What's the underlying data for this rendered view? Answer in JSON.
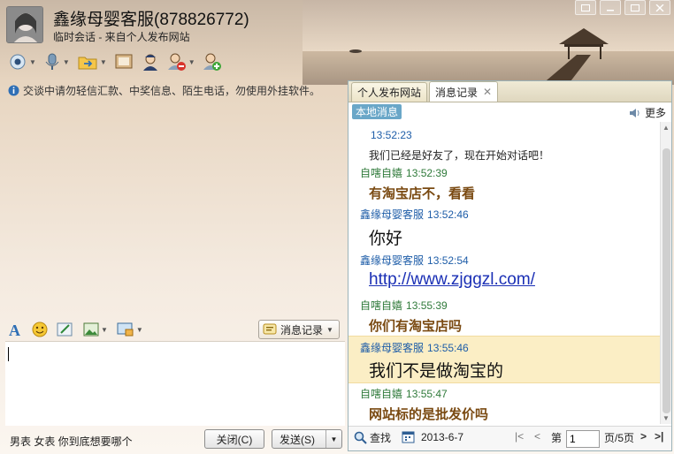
{
  "window": {
    "title": "鑫缘母婴客服(878826772)",
    "subtitle": "临时会话 - 来自个人发布网站"
  },
  "toolbar": {
    "items": [
      {
        "name": "video-call",
        "icon": "camera-icon"
      },
      {
        "name": "voice-call",
        "icon": "microphone-icon"
      },
      {
        "name": "send-file",
        "icon": "folder-icon"
      },
      {
        "name": "remote-assist",
        "icon": "monitor-icon"
      },
      {
        "name": "agent",
        "icon": "agent-icon"
      },
      {
        "name": "block-user",
        "icon": "remove-user-icon"
      },
      {
        "name": "add-friend",
        "icon": "add-user-icon"
      }
    ]
  },
  "notice": "交谈中请勿轻信汇款、中奖信息、陌生电话，勿使用外挂软件。",
  "format_bar": {
    "history_button": "消息记录"
  },
  "bottom": {
    "ad_text": "男表 女表 你到底想要哪个",
    "close_label": "关闭(C)",
    "send_label": "发送(S)"
  },
  "right_panel": {
    "tabs": [
      "个人发布网站",
      "消息记录"
    ],
    "active_tab": 1,
    "local_messages_label": "本地消息",
    "more_label": "更多",
    "messages": [
      {
        "sender": "",
        "time": "13:52:23",
        "text": "我们已经是好友了，现在开始对话吧！",
        "style": "sys"
      },
      {
        "sender": "自嗐自嬉",
        "time": "13:52:39",
        "text": "有淘宝店不，看看",
        "style": "bold"
      },
      {
        "sender": "鑫缘母婴客服",
        "time": "13:52:46",
        "text": "你好",
        "style": "big"
      },
      {
        "sender": "鑫缘母婴客服",
        "time": "13:52:54",
        "text": "http://www.zjggzl.com/",
        "style": "link"
      },
      {
        "sender": "自嗐自嬉",
        "time": "13:55:39",
        "text": "你们有淘宝店吗",
        "style": "bold"
      },
      {
        "sender": "鑫缘母婴客服",
        "time": "13:55:46",
        "text": "我们不是做淘宝的",
        "style": "big"
      },
      {
        "sender": "自嗐自嬉",
        "time": "13:55:47",
        "text": "网站标的是批发价吗",
        "style": "bold"
      }
    ],
    "pager": {
      "find_label": "查找",
      "date": "2013-6-7",
      "page_prefix": "第",
      "page_value": "1",
      "page_suffix": "页/5页"
    }
  },
  "colors": {
    "sender_self": "#2f7a3a",
    "sender_other": "#1e5da8",
    "bold_message": "#7a4a12",
    "link": "#1a2fb5",
    "highlight_row": "#fbeec5",
    "local_tag": "#6aa7c8"
  }
}
